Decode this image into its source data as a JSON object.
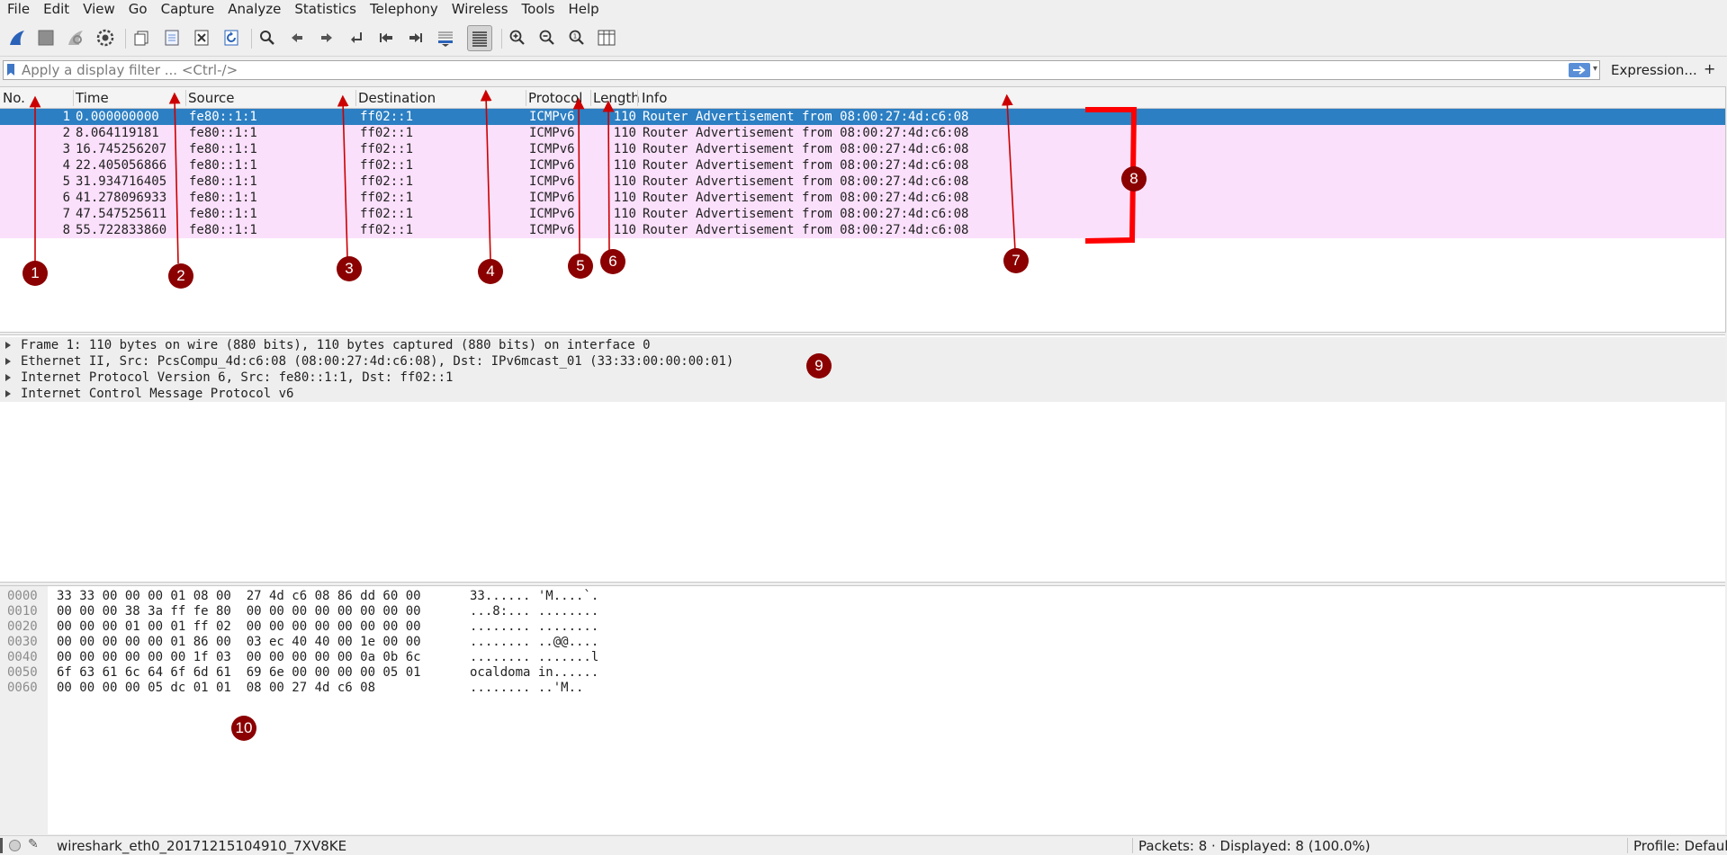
{
  "colors": {
    "selected_row": "#2c7fc3",
    "row_bg": "#fbe0fb",
    "badge": "#8b0000",
    "arrow": "#cc0000",
    "bracket": "#ff0000"
  },
  "menu": [
    "File",
    "Edit",
    "View",
    "Go",
    "Capture",
    "Analyze",
    "Statistics",
    "Telephony",
    "Wireless",
    "Tools",
    "Help"
  ],
  "toolbar": {
    "icons": [
      "shark-fin-start-icon",
      "stop-capture-icon",
      "restart-capture-icon",
      "capture-options-icon",
      "open-file-icon",
      "save-file-icon",
      "close-file-icon",
      "reload-file-icon",
      "find-packet-icon",
      "go-back-icon",
      "go-forward-icon",
      "go-to-packet-icon",
      "first-packet-icon",
      "last-packet-icon",
      "autoscroll-icon",
      "colorize-icon",
      "zoom-in-icon",
      "zoom-out-icon",
      "normal-size-icon",
      "resize-columns-icon"
    ]
  },
  "filter": {
    "placeholder": "Apply a display filter ... <Ctrl-/>",
    "expression_label": "Expression...",
    "plus_label": "+"
  },
  "packet_list": {
    "columns": [
      "No.",
      "Time",
      "Source",
      "Destination",
      "Protocol",
      "Length",
      "Info"
    ],
    "rows": [
      {
        "no": "1",
        "time": "0.000000000",
        "source": "fe80::1:1",
        "destination": "ff02::1",
        "protocol": "ICMPv6",
        "length": "110",
        "info": "Router Advertisement from 08:00:27:4d:c6:08"
      },
      {
        "no": "2",
        "time": "8.064119181",
        "source": "fe80::1:1",
        "destination": "ff02::1",
        "protocol": "ICMPv6",
        "length": "110",
        "info": "Router Advertisement from 08:00:27:4d:c6:08"
      },
      {
        "no": "3",
        "time": "16.745256207",
        "source": "fe80::1:1",
        "destination": "ff02::1",
        "protocol": "ICMPv6",
        "length": "110",
        "info": "Router Advertisement from 08:00:27:4d:c6:08"
      },
      {
        "no": "4",
        "time": "22.405056866",
        "source": "fe80::1:1",
        "destination": "ff02::1",
        "protocol": "ICMPv6",
        "length": "110",
        "info": "Router Advertisement from 08:00:27:4d:c6:08"
      },
      {
        "no": "5",
        "time": "31.934716405",
        "source": "fe80::1:1",
        "destination": "ff02::1",
        "protocol": "ICMPv6",
        "length": "110",
        "info": "Router Advertisement from 08:00:27:4d:c6:08"
      },
      {
        "no": "6",
        "time": "41.278096933",
        "source": "fe80::1:1",
        "destination": "ff02::1",
        "protocol": "ICMPv6",
        "length": "110",
        "info": "Router Advertisement from 08:00:27:4d:c6:08"
      },
      {
        "no": "7",
        "time": "47.547525611",
        "source": "fe80::1:1",
        "destination": "ff02::1",
        "protocol": "ICMPv6",
        "length": "110",
        "info": "Router Advertisement from 08:00:27:4d:c6:08"
      },
      {
        "no": "8",
        "time": "55.722833860",
        "source": "fe80::1:1",
        "destination": "ff02::1",
        "protocol": "ICMPv6",
        "length": "110",
        "info": "Router Advertisement from 08:00:27:4d:c6:08"
      }
    ]
  },
  "details": [
    "Frame 1: 110 bytes on wire (880 bits), 110 bytes captured (880 bits) on interface 0",
    "Ethernet II, Src: PcsCompu_4d:c6:08 (08:00:27:4d:c6:08), Dst: IPv6mcast_01 (33:33:00:00:00:01)",
    "Internet Protocol Version 6, Src: fe80::1:1, Dst: ff02::1",
    "Internet Control Message Protocol v6"
  ],
  "bytes": [
    {
      "offset": "0000",
      "hex": "33 33 00 00 00 01 08 00  27 4d c6 08 86 dd 60 00",
      "ascii": "33...... 'M....`."
    },
    {
      "offset": "0010",
      "hex": "00 00 00 38 3a ff fe 80  00 00 00 00 00 00 00 00",
      "ascii": "...8:... ........"
    },
    {
      "offset": "0020",
      "hex": "00 00 00 01 00 01 ff 02  00 00 00 00 00 00 00 00",
      "ascii": "........ ........"
    },
    {
      "offset": "0030",
      "hex": "00 00 00 00 00 01 86 00  03 ec 40 40 00 1e 00 00",
      "ascii": "........ ..@@...."
    },
    {
      "offset": "0040",
      "hex": "00 00 00 00 00 00 1f 03  00 00 00 00 00 0a 0b 6c",
      "ascii": "........ .......l"
    },
    {
      "offset": "0050",
      "hex": "6f 63 61 6c 64 6f 6d 61  69 6e 00 00 00 00 05 01",
      "ascii": "ocaldoma in......"
    },
    {
      "offset": "0060",
      "hex": "00 00 00 00 05 dc 01 01  08 00 27 4d c6 08",
      "ascii": "........ ..'M.."
    }
  ],
  "status": {
    "file": "wireshark_eth0_20171215104910_7XV8KE",
    "packets": "Packets: 8 · Displayed: 8 (100.0%)",
    "profile": "Profile: Default"
  },
  "annotations": [
    "1",
    "2",
    "3",
    "4",
    "5",
    "6",
    "7",
    "8",
    "9",
    "10"
  ]
}
